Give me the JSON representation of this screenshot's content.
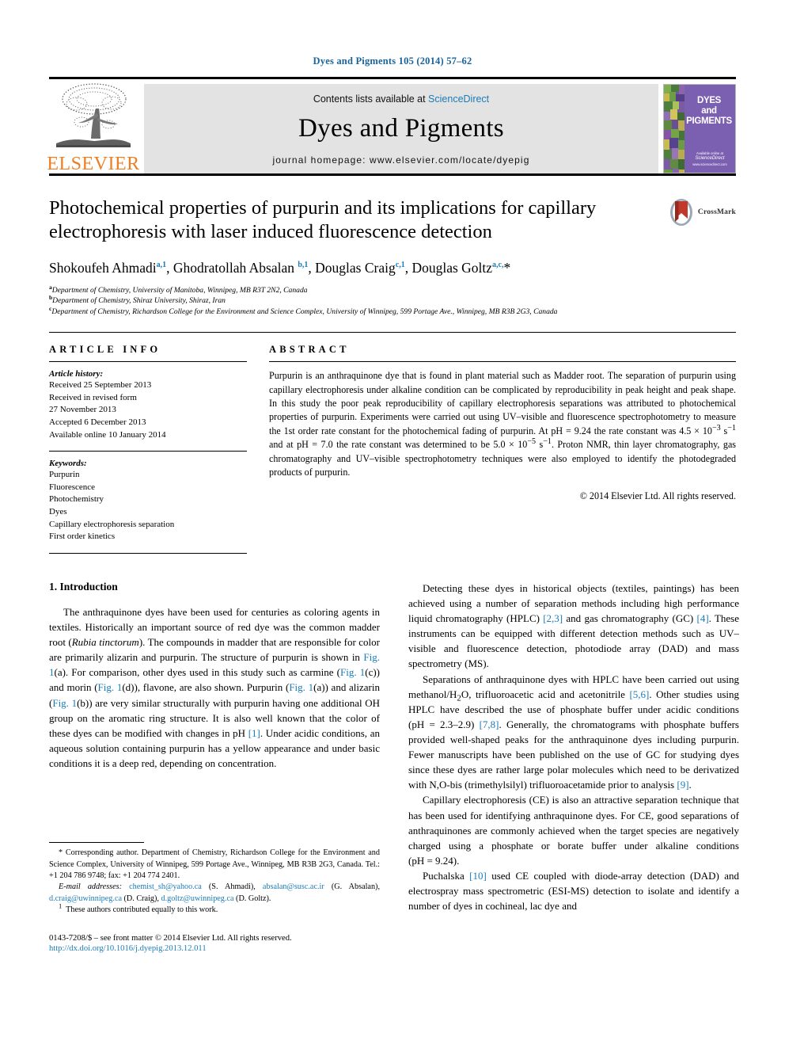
{
  "running_head": "Dyes and Pigments 105 (2014) 57–62",
  "masthead": {
    "publisher_name": "ELSEVIER",
    "contents_prefix": "Contents lists available at ",
    "contents_link": "ScienceDirect",
    "journal_name": "Dyes and Pigments",
    "homepage": "journal homepage: www.elsevier.com/locate/dyepig",
    "cover_title_line1": "DYES",
    "cover_title_line2": "and",
    "cover_title_line3": "PIGMENTS",
    "cover_foot_label": "Available online at",
    "cover_foot_brand": "ScienceDirect",
    "cover_foot_url": "www.sciencedirect.com",
    "cover_bg_color": "#7b5fb0",
    "accent_link_color": "#1a7cb8",
    "elsevier_orange": "#ef7d22"
  },
  "article": {
    "title": "Photochemical properties of purpurin and its implications for capillary electrophoresis with laser induced fluorescence detection",
    "crossmark_label": "CrossMark",
    "authors_html": "Shokoufeh Ahmadi<sup>a,1</sup>, Ghodratollah Absalan <sup>b,1</sup>, Douglas Craig<sup>c,1</sup>, Douglas Goltz<sup>a,c,</sup>*",
    "affiliations": [
      {
        "marker": "a",
        "text": "Department of Chemistry, University of Manitoba, Winnipeg, MB R3T 2N2, Canada"
      },
      {
        "marker": "b",
        "text": "Department of Chemistry, Shiraz University, Shiraz, Iran"
      },
      {
        "marker": "c",
        "text": "Department of Chemistry, Richardson College for the Environment and Science Complex, University of Winnipeg, 599 Portage Ave., Winnipeg, MB R3B 2G3, Canada"
      }
    ]
  },
  "article_info": {
    "heading": "ARTICLE INFO",
    "history_label": "Article history:",
    "history": [
      "Received 25 September 2013",
      "Received in revised form",
      "27 November 2013",
      "Accepted 6 December 2013",
      "Available online 10 January 2014"
    ],
    "keywords_label": "Keywords:",
    "keywords": [
      "Purpurin",
      "Fluorescence",
      "Photochemistry",
      "Dyes",
      "Capillary electrophoresis separation",
      "First order kinetics"
    ]
  },
  "abstract": {
    "heading": "ABSTRACT",
    "text_html": "Purpurin is an anthraquinone dye that is found in plant material such as Madder root. The separation of purpurin using capillary electrophoresis under alkaline condition can be complicated by reproducibility in peak height and peak shape. In this study the poor peak reproducibility of capillary electrophoresis separations was attributed to photochemical properties of purpurin. Experiments were carried out using UV&#8211;visible and fluorescence spectrophotometry to measure the 1st order rate constant for the photochemical fading of purpurin. At pH&nbsp;=&nbsp;9.24 the rate constant was 4.5&nbsp;&#215;&nbsp;10<sup>&#8722;3</sup>&nbsp;s<sup>&#8722;1</sup> and at pH&nbsp;=&nbsp;7.0 the rate constant was determined to be 5.0&nbsp;&#215;&nbsp;10<sup>&#8722;5</sup>&nbsp;s<sup>&#8722;1</sup>. Proton NMR, thin layer chromatography, gas chromatography and UV&#8211;visible spectrophotometry techniques were also employed to identify the photodegraded products of purpurin.",
    "copyright": "© 2014 Elsevier Ltd. All rights reserved."
  },
  "body": {
    "section_heading": "1. Introduction",
    "left_paragraphs_html": [
      "The anthraquinone dyes have been used for centuries as coloring agents in textiles. Historically an important source of red dye was the common madder root (<i>Rubia tinctorum</i>). The compounds in madder that are responsible for color are primarily alizarin and purpurin. The structure of purpurin is shown in <span class=\"ref\">Fig. 1</span>(a). For comparison, other dyes used in this study such as carmine (<span class=\"ref\">Fig. 1</span>(c)) and morin (<span class=\"ref\">Fig. 1</span>(d)), flavone, are also shown. Purpurin (<span class=\"ref\">Fig. 1</span>(a)) and alizarin (<span class=\"ref\">Fig. 1</span>(b)) are very similar structurally with purpurin having one additional OH group on the aromatic ring structure. It is also well known that the color of these dyes can be modified with changes in pH <span class=\"ref\">[1]</span>. Under acidic conditions, an aqueous solution containing purpurin has a yellow appearance and under basic conditions it is a deep red, depending on concentration."
    ],
    "right_paragraphs_html": [
      "Detecting these dyes in historical objects (textiles, paintings) has been achieved using a number of separation methods including high performance liquid chromatography (HPLC) <span class=\"ref\">[2,3]</span> and gas chromatography (GC) <span class=\"ref\">[4]</span>. These instruments can be equipped with different detection methods such as UV&#8211;visible and fluorescence detection, photodiode array (DAD) and mass spectrometry (MS).",
      "Separations of anthraquinone dyes with HPLC have been carried out using methanol/H<sub>2</sub>O, trifluoroacetic acid and acetonitrile <span class=\"ref\">[5,6]</span>. Other studies using HPLC have described the use of phosphate buffer under acidic conditions (pH&nbsp;=&nbsp;2.3&#8211;2.9) <span class=\"ref\">[7,8]</span>. Generally, the chromatograms with phosphate buffers provided well-shaped peaks for the anthraquinone dyes including purpurin. Fewer manuscripts have been published on the use of GC for studying dyes since these dyes are rather large polar molecules which need to be derivatized with N,O-bis (trimethylsilyl) trifluoroacetamide prior to analysis <span class=\"ref\">[9]</span>.",
      "Capillary electrophoresis (CE) is also an attractive separation technique that has been used for identifying anthraquinone dyes. For CE, good separations of anthraquinones are commonly achieved when the target species are negatively charged using a phosphate or borate buffer under alkaline conditions (pH&nbsp;=&nbsp;9.24).",
      "Puchalska <span class=\"ref\">[10]</span> used CE coupled with diode-array detection (DAD) and electrospray mass spectrometric (ESI-MS) detection to isolate and identify a number of dyes in cochineal, lac dye and"
    ]
  },
  "footnotes": {
    "corresponding_html": "* Corresponding author. Department of Chemistry, Richardson College for the Environment and Science Complex, University of Winnipeg, 599 Portage Ave., Winnipeg, MB R3B 2G3, Canada. Tel.: +1 204 786 9748; fax: +1 204 774 2401.",
    "emails_html": "<em>E-mail addresses:</em> <span class=\"ref\">chemist_sh@yahoo.ca</span> (S. Ahmadi), <span class=\"ref\">absalan@susc.ac.ir</span> (G. Absalan), <span class=\"ref\">d.craig@uwinnipeg.ca</span> (D. Craig), <span class=\"ref\">d.goltz@uwinnipeg.ca</span> (D. Goltz).",
    "equal_contrib_html": "<sup>1</sup>&nbsp; These authors contributed equally to this work.",
    "issn_html": "0143-7208/$ &#8211; see front matter &#169; 2014 Elsevier Ltd. All rights reserved.",
    "doi": "http://dx.doi.org/10.1016/j.dyepig.2013.12.011"
  }
}
